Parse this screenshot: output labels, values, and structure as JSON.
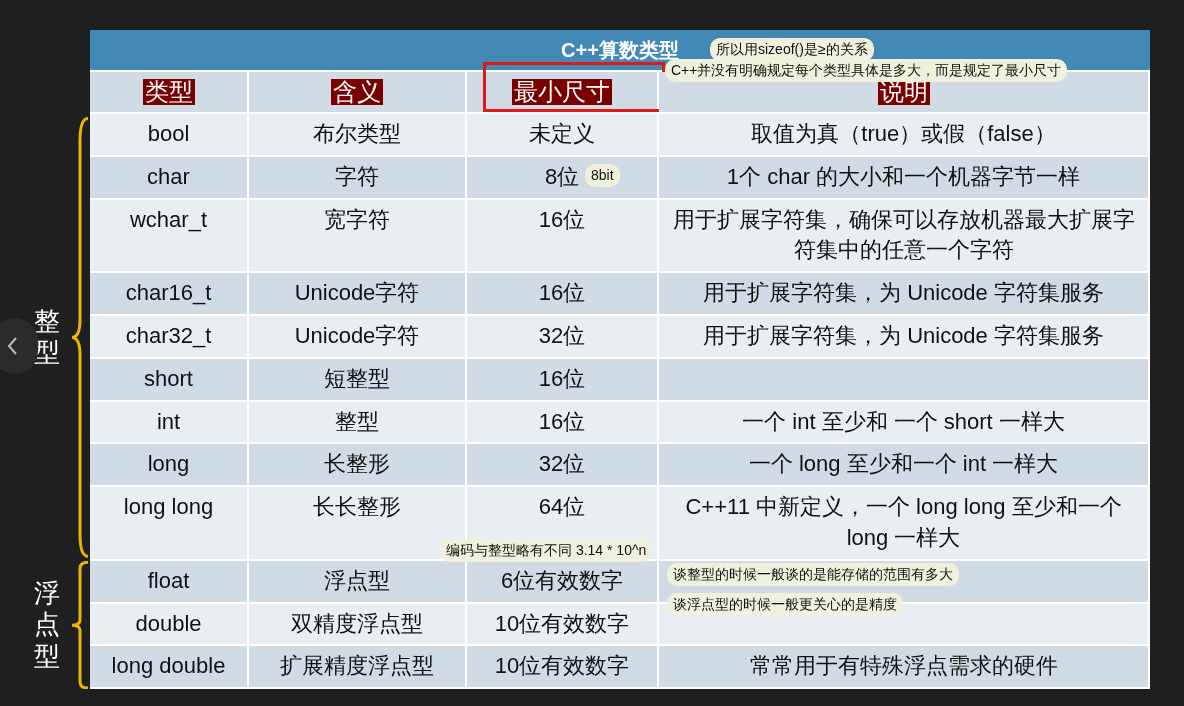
{
  "slide": {
    "title": "C++算数类型",
    "columns": [
      {
        "label": "类型",
        "highlighted": false
      },
      {
        "label": "含义",
        "highlighted": false
      },
      {
        "label": "最小尺寸",
        "highlighted": true
      },
      {
        "label": "说明",
        "highlighted": false
      }
    ],
    "groups": [
      {
        "label": "整型",
        "rows": [
          {
            "type": "bool",
            "meaning": "布尔类型",
            "min_size": "未定义",
            "description": "取值为真（true）或假（false）"
          },
          {
            "type": "char",
            "meaning": "字符",
            "min_size": "8位",
            "description": "1个 char 的大小和一个机器字节一样"
          },
          {
            "type": "wchar_t",
            "meaning": "宽字符",
            "min_size": "16位",
            "description": "用于扩展字符集，确保可以存放机器最大扩展字符集中的任意一个字符"
          },
          {
            "type": "char16_t",
            "meaning": "Unicode字符",
            "min_size": "16位",
            "description": "用于扩展字符集，为 Unicode 字符集服务"
          },
          {
            "type": "char32_t",
            "meaning": "Unicode字符",
            "min_size": "32位",
            "description": "用于扩展字符集，为 Unicode 字符集服务"
          },
          {
            "type": "short",
            "meaning": "短整型",
            "min_size": "16位"
          },
          {
            "type": "int",
            "meaning": "整型",
            "min_size": "16位",
            "description": "一个 int 至少和 一个 short 一样大"
          },
          {
            "type": "long",
            "meaning": "长整形",
            "min_size": "32位",
            "description": "一个 long 至少和一个 int 一样大"
          },
          {
            "type": "long long",
            "meaning": "长长整形",
            "min_size": "64位",
            "description": "C++11 中新定义，一个 long long 至少和一个 long 一样大"
          }
        ]
      },
      {
        "label": "浮点型",
        "rows": [
          {
            "type": "float",
            "meaning": "浮点型",
            "min_size": "6位有效数字"
          },
          {
            "type": "double",
            "meaning": "双精度浮点型",
            "min_size": "10位有效数字"
          },
          {
            "type": "long double",
            "meaning": "扩展精度浮点型",
            "min_size": "10位有效数字",
            "description": "常常用于有特殊浮点需求的硬件"
          }
        ]
      }
    ]
  },
  "notes": [
    "所以用sizeof()是≥的关系",
    "C++并没有明确规定每个类型具体是多大，而是规定了最小尺寸",
    "8bit",
    "编码与整型略有不同 3.14 * 10^n",
    "谈整型的时候一般谈的是能存储的范围有多大",
    "谈浮点型的时候一般更关心的是精度"
  ]
}
